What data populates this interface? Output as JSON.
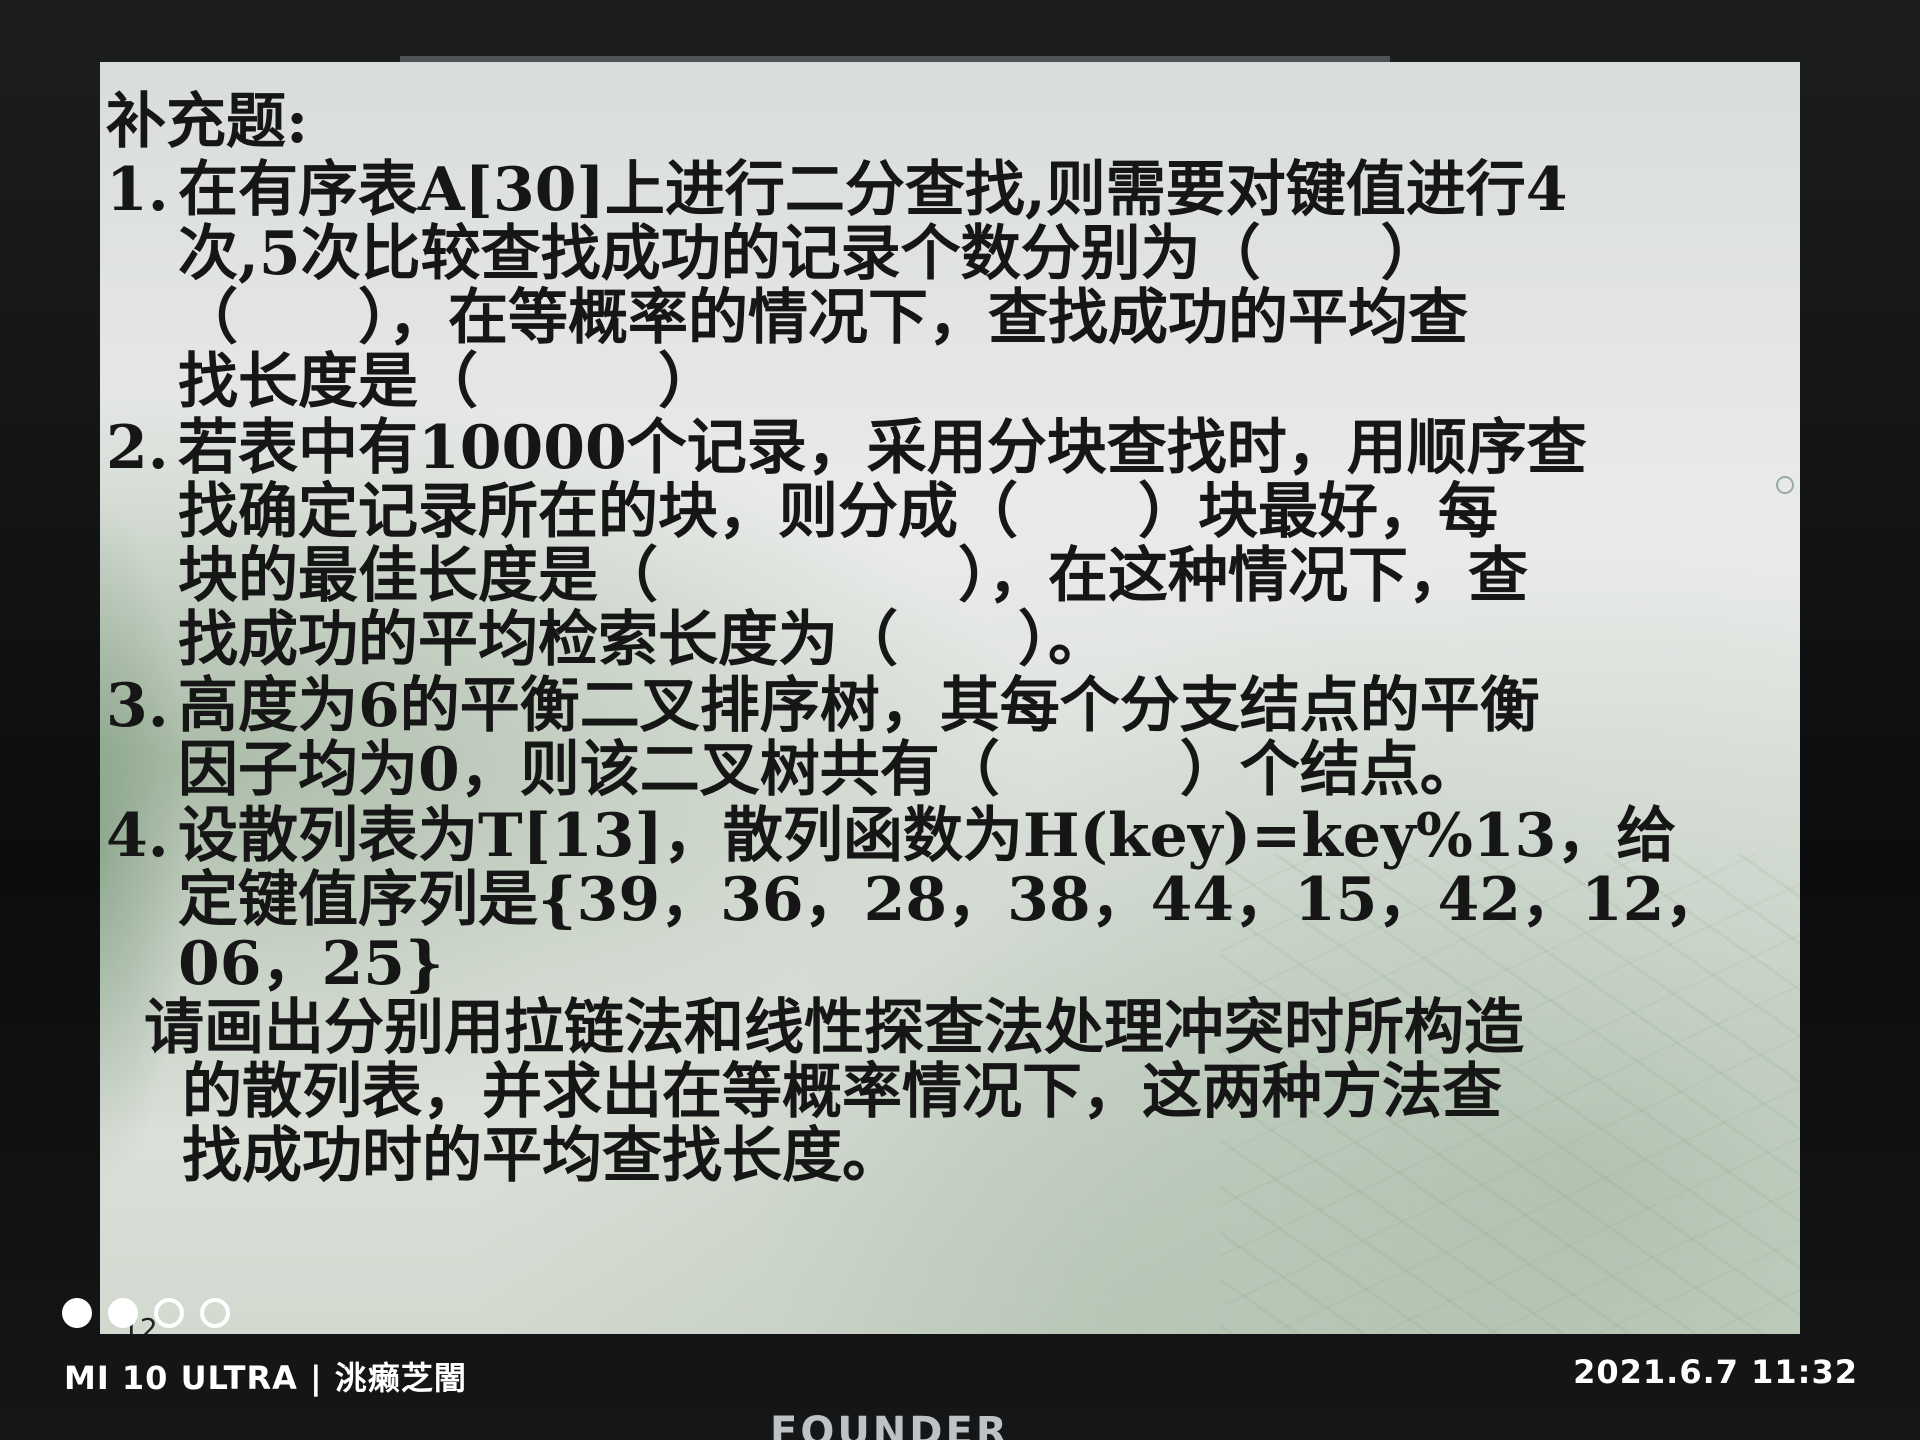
{
  "slide": {
    "heading": "补充题:",
    "questions": [
      {
        "num": "1.",
        "lines": [
          "在有序表A[30]上进行二分查找,则需要对键值进行4",
          "次,5次比较查找成功的记录个数分别为（　　）",
          "（　　），在等概率的情况下，查找成功的平均查",
          "找长度是（　　　）"
        ]
      },
      {
        "num": "2.",
        "lines": [
          "若表中有10000个记录，采用分块查找时，用顺序查",
          "找确定记录所在的块，则分成（　　）块最好，每",
          "块的最佳长度是（　　　　　），在这种情况下，查",
          "找成功的平均检索长度为（　　）。"
        ]
      },
      {
        "num": "3.",
        "lines": [
          "高度为6的平衡二叉排序树，其每个分支结点的平衡",
          "因子均为0，则该二叉树共有（　　　）个结点。"
        ]
      },
      {
        "num": "4.",
        "lines": [
          "设散列表为T[13]，散列函数为H(key)=key%13，给",
          "定键值序列是{39，36，28，38，44，15，42，12，",
          "06，25}"
        ]
      }
    ],
    "tail_lines": [
      "请画出分别用拉链法和线性探查法处理冲突时所构造",
      "的散列表，并求出在等概率情况下，这两种方法查",
      "找成功时的平均查找长度。"
    ],
    "slide_number": "12"
  },
  "photo": {
    "device_watermark": "MI 10 ULTRA | 洮癞芝闇",
    "timestamp": "2021.6.7 11:32",
    "monitor_brand": "FOUNDER",
    "page_dots": [
      true,
      true,
      false,
      false
    ]
  }
}
